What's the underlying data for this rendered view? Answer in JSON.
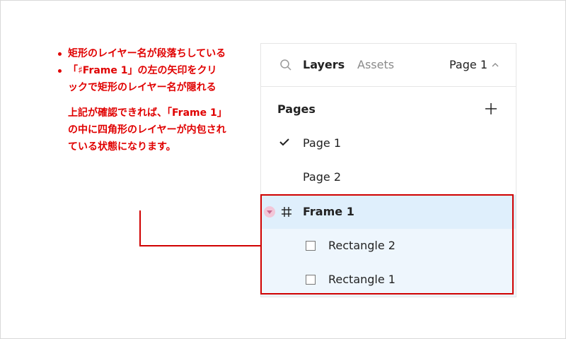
{
  "annotation": {
    "bullets": [
      "矩形のレイヤー名が段落ちしている",
      "「♯Frame 1」の左の矢印をクリックで矩形のレイヤー名が隠れる"
    ],
    "paragraph": "上記が確認できれば、「Frame 1」の中に四角形のレイヤーが内包されている状態になります。",
    "color": "#e00000"
  },
  "panel": {
    "tabs": {
      "layers": "Layers",
      "assets": "Assets"
    },
    "current_page": "Page 1",
    "pages_title": "Pages",
    "pages": [
      {
        "label": "Page 1",
        "checked": true
      },
      {
        "label": "Page 2",
        "checked": false
      }
    ],
    "layers": [
      {
        "label": "Frame 1",
        "type": "frame",
        "expanded": true
      },
      {
        "label": "Rectangle 2",
        "type": "rectangle"
      },
      {
        "label": "Rectangle 1",
        "type": "rectangle"
      }
    ]
  },
  "icons": {
    "search": "search-icon",
    "chevron": "chevron-up-icon",
    "add": "plus-icon",
    "check": "check-icon",
    "frame": "frame-hash-icon",
    "rectangle": "rectangle-icon",
    "toggle": "caret-down-icon"
  }
}
